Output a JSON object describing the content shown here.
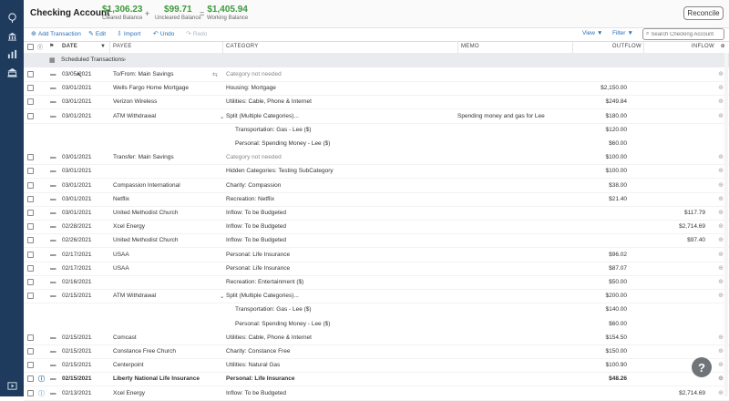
{
  "sidebar": {
    "icons": [
      "budget-icon",
      "bank-icon",
      "chart-icon",
      "institution-icon",
      "play-icon"
    ]
  },
  "header": {
    "account_name": "Checking Account",
    "cleared": {
      "amount": "$1,306.23",
      "label": "Cleared Balance"
    },
    "uncleared": {
      "amount": "$99.71",
      "label": "Uncleared Balance"
    },
    "working": {
      "amount": "$1,405.94",
      "label": "Working Balance"
    },
    "plus": "+",
    "equals": "=",
    "reconcile_label": "Reconcile"
  },
  "toolbar": {
    "add": "Add Transaction",
    "edit": "Edit",
    "import": "Import",
    "undo": "Undo",
    "redo": "Redo",
    "view": "View",
    "filter": "Filter",
    "search_placeholder": "Search Checking Account"
  },
  "columns": {
    "date": "DATE",
    "payee": "PAYEE",
    "category": "CATEGORY",
    "memo": "MEMO",
    "outflow": "OUTFLOW",
    "inflow": "INFLOW"
  },
  "scheduled": {
    "label": "Scheduled Transactions",
    "chevron": "›"
  },
  "rows": [
    {
      "date": "03/05/2021",
      "payee": "To/From: Main Savings",
      "category": "Category not needed",
      "memo": "",
      "outflow": "",
      "inflow": ""
    },
    {
      "date": "03/01/2021",
      "payee": "Wells Fargo Home Mortgage",
      "category": "Housing: Mortgage",
      "memo": "",
      "outflow": "$2,150.00",
      "inflow": ""
    },
    {
      "date": "03/01/2021",
      "payee": "Verizon Wireless",
      "category": "Utilities: Cable, Phone & Internet",
      "memo": "",
      "outflow": "$249.84",
      "inflow": ""
    },
    {
      "date": "03/01/2021",
      "payee": "ATM Withdrawal",
      "category": "Split (Multiple Categories)...",
      "memo": "Spending money and gas for Lee",
      "outflow": "$180.00",
      "inflow": ""
    },
    {
      "date": "",
      "payee": "",
      "category": "Transportation: Gas - Lee ($)",
      "memo": "",
      "outflow": "$120.00",
      "inflow": ""
    },
    {
      "date": "",
      "payee": "",
      "category": "Personal: Spending Money - Lee ($)",
      "memo": "",
      "outflow": "$60.00",
      "inflow": ""
    },
    {
      "date": "03/01/2021",
      "payee": "Transfer: Main Savings",
      "category": "Category not needed",
      "memo": "",
      "outflow": "$100.00",
      "inflow": ""
    },
    {
      "date": "03/01/2021",
      "payee": "",
      "category": "Hidden Categories: Testing SubCategory",
      "memo": "",
      "outflow": "$100.00",
      "inflow": ""
    },
    {
      "date": "03/01/2021",
      "payee": "Compassion International",
      "category": "Charity: Compassion",
      "memo": "",
      "outflow": "$38.00",
      "inflow": ""
    },
    {
      "date": "03/01/2021",
      "payee": "Netflix",
      "category": "Recreation: Netflix",
      "memo": "",
      "outflow": "$21.40",
      "inflow": ""
    },
    {
      "date": "03/01/2021",
      "payee": "United Methodist Church",
      "category": "Inflow: To be Budgeted",
      "memo": "",
      "outflow": "",
      "inflow": "$117.79"
    },
    {
      "date": "02/28/2021",
      "payee": "Xcel Energy",
      "category": "Inflow: To be Budgeted",
      "memo": "",
      "outflow": "",
      "inflow": "$2,714.69"
    },
    {
      "date": "02/26/2021",
      "payee": "United Methodist Church",
      "category": "Inflow: To be Budgeted",
      "memo": "",
      "outflow": "",
      "inflow": "$97.40"
    },
    {
      "date": "02/17/2021",
      "payee": "USAA",
      "category": "Personal: Life Insurance",
      "memo": "",
      "outflow": "$96.02",
      "inflow": ""
    },
    {
      "date": "02/17/2021",
      "payee": "USAA",
      "category": "Personal: Life Insurance",
      "memo": "",
      "outflow": "$87.07",
      "inflow": ""
    },
    {
      "date": "02/16/2021",
      "payee": "",
      "category": "Recreation: Entertainment ($)",
      "memo": "",
      "outflow": "$50.00",
      "inflow": ""
    },
    {
      "date": "02/15/2021",
      "payee": "ATM Withdrawal",
      "category": "Split (Multiple Categories)...",
      "memo": "",
      "outflow": "$200.00",
      "inflow": ""
    },
    {
      "date": "",
      "payee": "",
      "category": "Transportation: Gas - Lee ($)",
      "memo": "",
      "outflow": "$140.00",
      "inflow": ""
    },
    {
      "date": "",
      "payee": "",
      "category": "Personal: Spending Money - Lee ($)",
      "memo": "",
      "outflow": "$60.00",
      "inflow": ""
    },
    {
      "date": "02/15/2021",
      "payee": "Comcast",
      "category": "Utilities: Cable, Phone & Internet",
      "memo": "",
      "outflow": "$154.50",
      "inflow": ""
    },
    {
      "date": "02/15/2021",
      "payee": "Constance Free Church",
      "category": "Charity: Constance Free",
      "memo": "",
      "outflow": "$150.00",
      "inflow": ""
    },
    {
      "date": "02/15/2021",
      "payee": "Centerpoint",
      "category": "Utilities: Natural Gas",
      "memo": "",
      "outflow": "$100.90",
      "inflow": ""
    },
    {
      "date": "02/15/2021",
      "payee": "Liberty National Life Insurance",
      "category": "Personal: Life Insurance",
      "memo": "",
      "outflow": "$48.26",
      "inflow": ""
    },
    {
      "date": "02/13/2021",
      "payee": "Xcel Energy",
      "category": "Inflow: To be Budgeted",
      "memo": "",
      "outflow": "",
      "inflow": "$2,714.69"
    }
  ],
  "help_label": "?"
}
